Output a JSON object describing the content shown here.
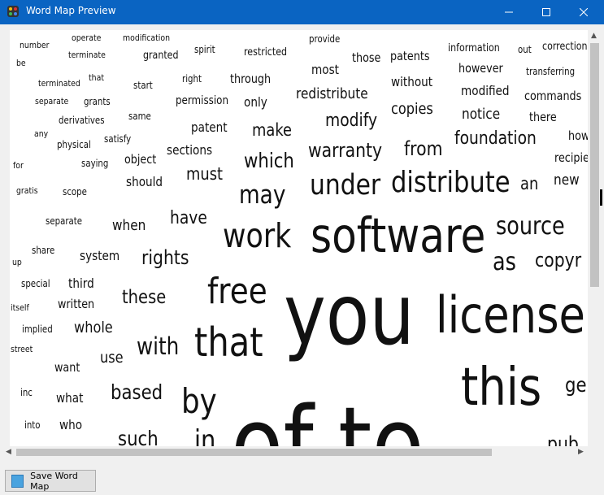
{
  "window": {
    "title": "Word Map Preview",
    "icon": "app-palette-icon",
    "controls": [
      "minimize-icon",
      "maximize-icon",
      "close-icon"
    ]
  },
  "wordmap": {
    "words": [
      "number",
      "operate",
      "modification",
      "spirit",
      "restricted",
      "provide",
      "information",
      "out",
      "correction",
      "be",
      "terminate",
      "granted",
      "those",
      "patents",
      "terminated",
      "that",
      "start",
      "right",
      "through",
      "most",
      "without",
      "however",
      "transferring",
      "separate",
      "grants",
      "permission",
      "only",
      "redistribute",
      "modified",
      "commands",
      "derivatives",
      "same",
      "patent",
      "make",
      "copies",
      "notice",
      "there",
      "any",
      "satisfy",
      "modify",
      "foundation",
      "how",
      "physical",
      "for",
      "saying",
      "object",
      "sections",
      "warranty",
      "from",
      "recipie",
      "should",
      "must",
      "which",
      "gratis",
      "scope",
      "distribute",
      "an",
      "new",
      "under",
      "may",
      "separate",
      "when",
      "have",
      "software",
      "source",
      "work",
      "share",
      "system",
      "rights",
      "up",
      "as",
      "copyr",
      "special",
      "third",
      "free",
      "itself",
      "written",
      "these",
      "license",
      "implied",
      "whole",
      "you",
      "with",
      "that",
      "street",
      "use",
      "want",
      "this",
      "ge",
      "inc",
      "what",
      "based",
      "by",
      "into",
      "who",
      "such",
      "in",
      "of",
      "to",
      "pub"
    ]
  },
  "footer": {
    "save_label": "Save Word Map"
  }
}
